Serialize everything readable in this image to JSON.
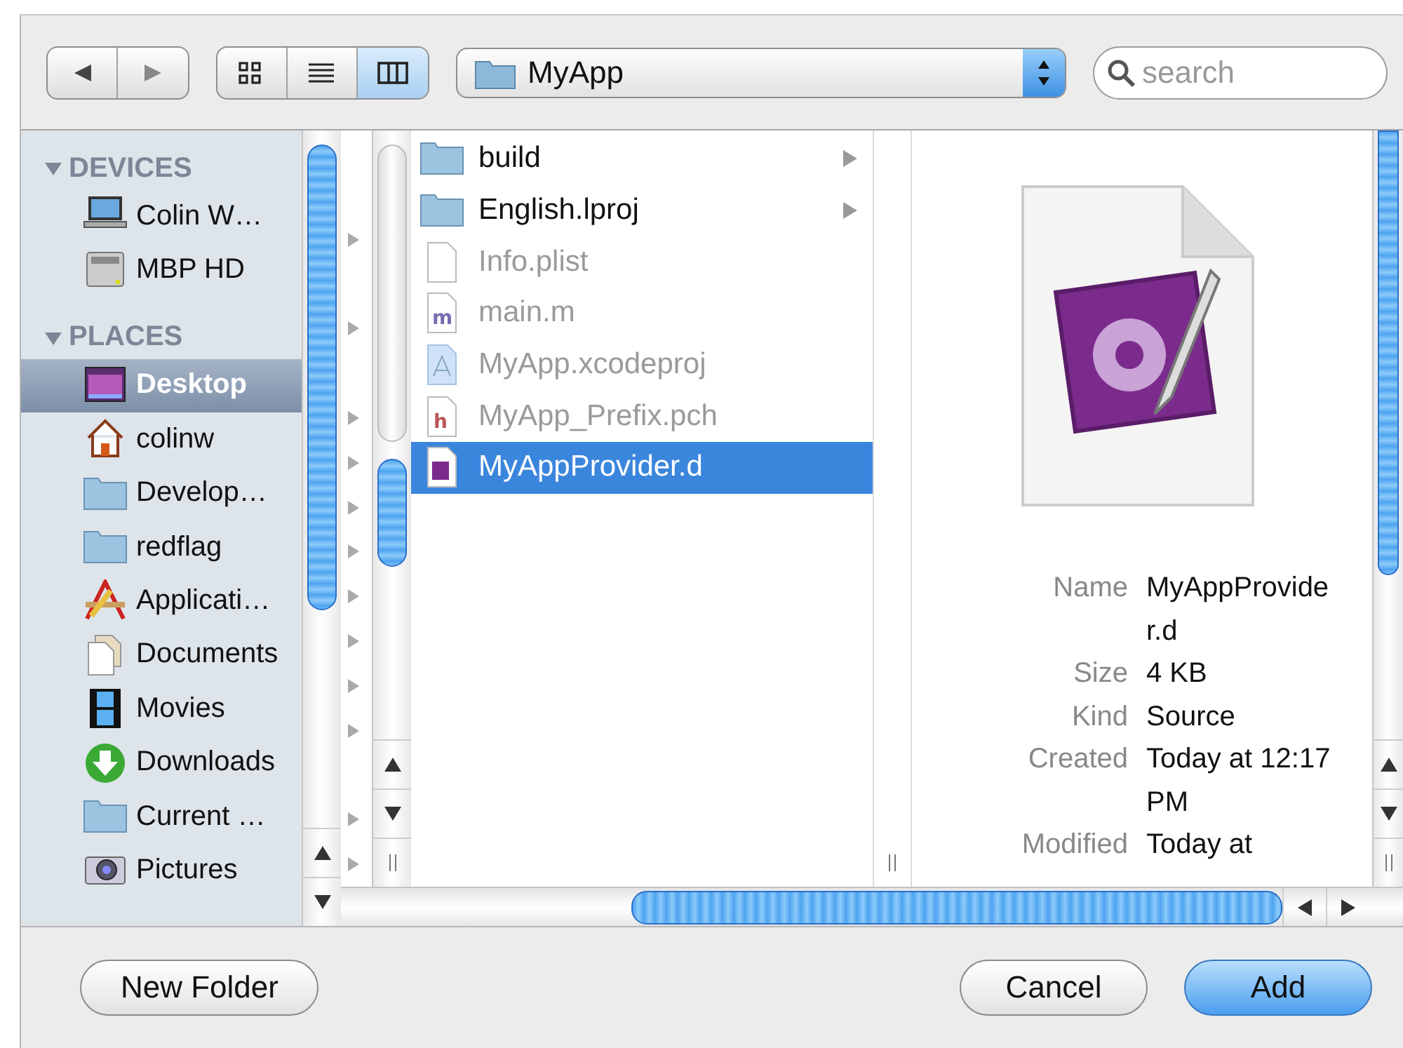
{
  "toolbar": {
    "location": "MyApp",
    "search": {
      "placeholder": "search"
    },
    "views": [
      {
        "selected": false
      },
      {
        "selected": false
      },
      {
        "selected": true
      }
    ]
  },
  "sidebar": {
    "sections": [
      {
        "title": "DEVICES",
        "expanded": true,
        "items": [
          {
            "label": "Colin W…",
            "selected": false
          },
          {
            "label": "MBP HD",
            "selected": false
          }
        ]
      },
      {
        "title": "PLACES",
        "expanded": true,
        "items": [
          {
            "label": "Desktop",
            "selected": true
          },
          {
            "label": "colinw",
            "selected": false
          },
          {
            "label": "Develop…",
            "selected": false
          },
          {
            "label": "redflag",
            "selected": false
          },
          {
            "label": "Applicati…",
            "selected": false
          },
          {
            "label": "Documents",
            "selected": false
          },
          {
            "label": "Movies",
            "selected": false
          },
          {
            "label": "Downloads",
            "selected": false
          },
          {
            "label": "Current …",
            "selected": false
          },
          {
            "label": "Pictures",
            "selected": false
          }
        ]
      }
    ]
  },
  "files": [
    {
      "name": "build",
      "kind": "folder",
      "disabled": false,
      "selected": false
    },
    {
      "name": "English.lproj",
      "kind": "folder",
      "disabled": false,
      "selected": false
    },
    {
      "name": "Info.plist",
      "kind": "plist",
      "disabled": true,
      "selected": false
    },
    {
      "name": "main.m",
      "kind": "m",
      "disabled": true,
      "selected": false
    },
    {
      "name": "MyApp.xcodeproj",
      "kind": "project",
      "disabled": true,
      "selected": false
    },
    {
      "name": "MyApp_Prefix.pch",
      "kind": "h",
      "disabled": true,
      "selected": false
    },
    {
      "name": "MyAppProvider.d",
      "kind": "d",
      "disabled": false,
      "selected": true
    }
  ],
  "preview": {
    "info": [
      {
        "label": "Name",
        "value": "MyAppProvider.d"
      },
      {
        "label": "Size",
        "value": "4 KB"
      },
      {
        "label": "Kind",
        "value": "Source"
      },
      {
        "label": "Created",
        "value": "Today at 12:17 PM"
      },
      {
        "label": "Modified",
        "value": "Today at"
      }
    ]
  },
  "buttons": [
    {
      "label": "New Folder",
      "default": false
    },
    {
      "label": "Cancel",
      "default": false
    },
    {
      "label": "Add",
      "default": true
    }
  ]
}
